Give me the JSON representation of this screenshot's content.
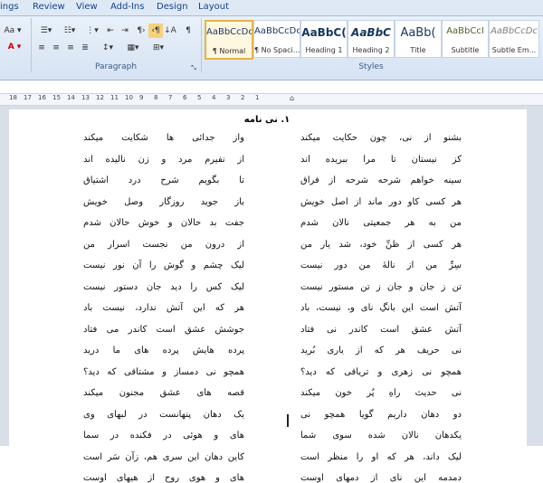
{
  "ribbon": {
    "tabs": [
      "ings",
      "Review",
      "View",
      "Add-Ins",
      "Design",
      "Layout"
    ],
    "groups": {
      "paragraph": "Paragraph",
      "styles": "Styles"
    },
    "styles": [
      {
        "preview": "AaBbCcDc",
        "name": "¶ Normal",
        "selected": true
      },
      {
        "preview": "AaBbCcDc",
        "name": "¶ No Spaci..."
      },
      {
        "preview": "AaBbC(",
        "name": "Heading 1"
      },
      {
        "preview": "AaBbC",
        "name": "Heading 2"
      },
      {
        "preview": "AaBb(",
        "name": "Title"
      },
      {
        "preview": "AaBbCcI",
        "name": "Subtitle"
      },
      {
        "preview": "AaBbCcDc",
        "name": "Subtle Em..."
      }
    ],
    "change_styles_icon": "change-styles-icon"
  },
  "ruler": {
    "ticks": [
      "18",
      "17",
      "16",
      "15",
      "14",
      "13",
      "12",
      "11",
      "10",
      "9",
      "8",
      "7",
      "6",
      "5",
      "4",
      "3",
      "2",
      "1"
    ]
  },
  "document": {
    "heading": "۱. نی نامه",
    "left_column": [
      "واز جدائی ها شکایت میکند",
      "از نفیرم مرد و زن نالیده اند",
      "تا بگویم شرح درد اشتیاق",
      "باز جوید روزگار وصل خویش",
      "جفت بد حالان و خوش حالان شدم",
      "از درون من نجست اسرار من",
      "لیک چشم و گوش را آن نور نیست",
      "لیک کس را دید جان دستور نیست",
      "هر که این آتش ندارد، نیست باد",
      "جوشش عشق است کاندر می فتاد",
      "پرده هایش پرده های ما درید",
      "همچو نی دمساز و مشتاقی که دید؟",
      "قصه های عشق مجنون میکند",
      "یک دهان پنهانست در لبهای وی",
      "های و هوئی در فکنده در سما",
      "کاین دهان این سری هم، زآن سَر است",
      "های و هوی روح از هیهای اوست"
    ],
    "right_column": [
      "بشنو از نی، چون حکایت میکند",
      "کز نیستان تا مرا ببریده اند",
      "سینه خواهم شرحه شرحه از فراق",
      "هر کسی کاو دور ماند از اصل خویش",
      "من به هر جمعیتی نالان شدم",
      "هر کسی از ظنِّ خود، شد یار من",
      "سِرِّ من از نالهٔ من دور نیست",
      "تن ز جان و جان ز تن مستور نیست",
      "آتش است این بانگِ نای و، نیست، باد",
      "آتش عشق است کاندر نی فتاد",
      "نی حریف هر که از یاری بُرید",
      "همچو نی زهری و تریاقی که دید؟",
      "نی حدیث راهِ پُر خون میکند",
      "دو دهان داریم گویا همچو نی",
      "یکدهان نالان شده سوی شما",
      "لیک داند، هر که او را منظر است",
      "دمدمه این نای از دمهای اوست"
    ]
  }
}
